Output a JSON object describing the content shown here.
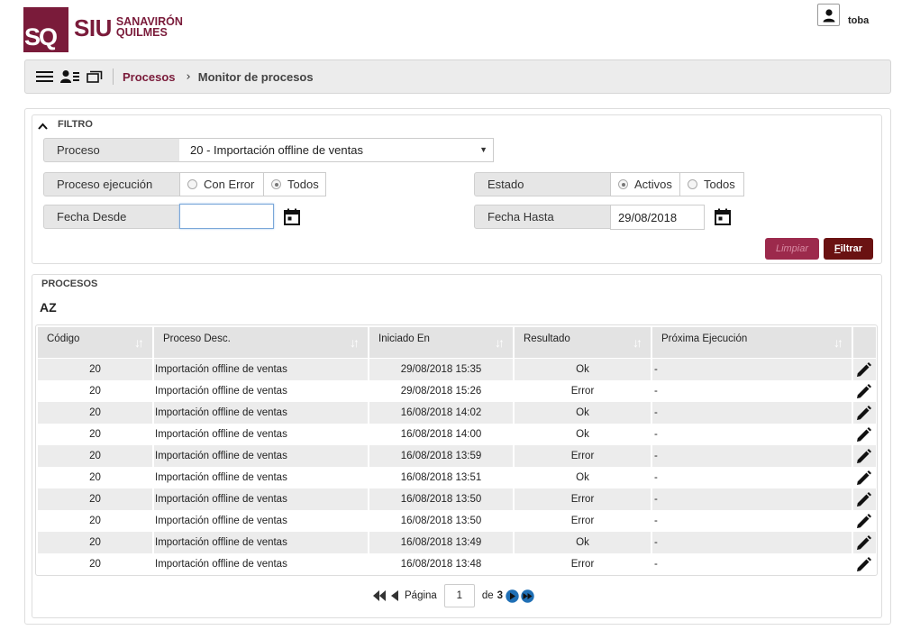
{
  "header": {
    "logo_mark": "SQ",
    "logo_siu": "SIU",
    "logo_line1": "SANAVIRÓN",
    "logo_line2": "QUILMES",
    "user_name": "toba"
  },
  "toolbar": {
    "icons": [
      "menu-icon",
      "user-list-icon",
      "windows-icon"
    ],
    "breadcrumb_link": "Procesos",
    "breadcrumb_separator": "›",
    "breadcrumb_current": "Monitor de procesos"
  },
  "filter": {
    "title": "FILTRO",
    "proceso_label": "Proceso",
    "proceso_value": "20 - Importación offline de ventas",
    "proceso_ejecucion_label": "Proceso ejecución",
    "ejecucion_options": [
      "Con Error",
      "Todos"
    ],
    "ejecucion_selected": "Todos",
    "estado_label": "Estado",
    "estado_options": [
      "Activos",
      "Todos"
    ],
    "estado_selected": "Activos",
    "fecha_desde_label": "Fecha Desde",
    "fecha_desde_value": "",
    "fecha_hasta_label": "Fecha Hasta",
    "fecha_hasta_value": "29/08/2018",
    "limpiar_label": "Limpiar",
    "filtrar_accesskey": "F",
    "filtrar_rest": "iltrar"
  },
  "procesos": {
    "title": "PROCESOS",
    "sort_az": "AZ",
    "columns": [
      "Código",
      "Proceso Desc.",
      "Iniciado En",
      "Resultado",
      "Próxima Ejecución"
    ],
    "rows": [
      {
        "codigo": "20",
        "desc": "Importación offline de ventas",
        "iniciado": "29/08/2018 15:35",
        "resultado": "Ok",
        "proxima": "-"
      },
      {
        "codigo": "20",
        "desc": "Importación offline de ventas",
        "iniciado": "29/08/2018 15:26",
        "resultado": "Error",
        "proxima": "-"
      },
      {
        "codigo": "20",
        "desc": "Importación offline de ventas",
        "iniciado": "16/08/2018 14:02",
        "resultado": "Ok",
        "proxima": "-"
      },
      {
        "codigo": "20",
        "desc": "Importación offline de ventas",
        "iniciado": "16/08/2018 14:00",
        "resultado": "Ok",
        "proxima": "-"
      },
      {
        "codigo": "20",
        "desc": "Importación offline de ventas",
        "iniciado": "16/08/2018 13:59",
        "resultado": "Error",
        "proxima": "-"
      },
      {
        "codigo": "20",
        "desc": "Importación offline de ventas",
        "iniciado": "16/08/2018 13:51",
        "resultado": "Ok",
        "proxima": "-"
      },
      {
        "codigo": "20",
        "desc": "Importación offline de ventas",
        "iniciado": "16/08/2018 13:50",
        "resultado": "Error",
        "proxima": "-"
      },
      {
        "codigo": "20",
        "desc": "Importación offline de ventas",
        "iniciado": "16/08/2018 13:50",
        "resultado": "Error",
        "proxima": "-"
      },
      {
        "codigo": "20",
        "desc": "Importación offline de ventas",
        "iniciado": "16/08/2018 13:49",
        "resultado": "Ok",
        "proxima": "-"
      },
      {
        "codigo": "20",
        "desc": "Importación offline de ventas",
        "iniciado": "16/08/2018 13:48",
        "resultado": "Error",
        "proxima": "-"
      }
    ]
  },
  "pager": {
    "pagina_label": "Página",
    "current_page": "1",
    "de_label": "de",
    "total_pages": "3"
  },
  "colors": {
    "brand": "#7a1b3a",
    "filtrar_bg": "#6a1212",
    "limpiar_bg": "#9c2a4c",
    "pager_blue": "#1f6fb5"
  }
}
